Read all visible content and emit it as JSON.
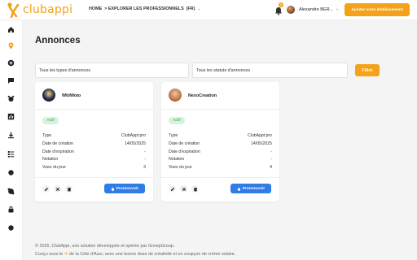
{
  "header": {
    "logo_text": "clubappi",
    "nav_home": "HOME",
    "nav_explore": "> EXPLORER LES PROFESSIONNELS",
    "nav_lang": "(FR)",
    "notification_count": "1",
    "user_name": "Alexandre BER...",
    "add_button": "Ajouter votre établissement",
    "brand_color": "#f3a21a"
  },
  "sidebar": {
    "icons": [
      "home-icon",
      "location-pin-icon",
      "add-circle-icon",
      "chat-icon",
      "alarm-icon",
      "chart-icon",
      "download-icon",
      "list-icon",
      "dot-icon",
      "skype-icon",
      "lock-icon",
      "dot-icon"
    ]
  },
  "main": {
    "title": "Annonces",
    "filter_type": "Tous les types d'annonces",
    "filter_status": "Tous les statuts d'annonces",
    "filter_button": "Filtre"
  },
  "labels": {
    "type": "Type",
    "created": "Date de création",
    "expires": "Date d'expiration",
    "rating": "Notation",
    "views": "Vues du jour",
    "promote": "Promouvoir"
  },
  "cards": [
    {
      "name": "WitiWoto",
      "status": "Actif",
      "type": "ClubAppi:pro",
      "created": "14/05/2025",
      "expires": "-",
      "rating": "-",
      "views": "3"
    },
    {
      "name": "NexoCreation",
      "status": "Actif",
      "type": "ClubAppi:pro",
      "created": "14/05/2025",
      "expires": "-",
      "rating": "-",
      "views": "4"
    }
  ],
  "footer": {
    "line1": "© 2025, ClubAppi, une solution développée et opérée par GrewpGroup.",
    "line2_a": "Conçu sous le",
    "line2_b": "de la Côte d'Azur, avec une bonne dose de créativité et un soupçon de crème solaire."
  }
}
